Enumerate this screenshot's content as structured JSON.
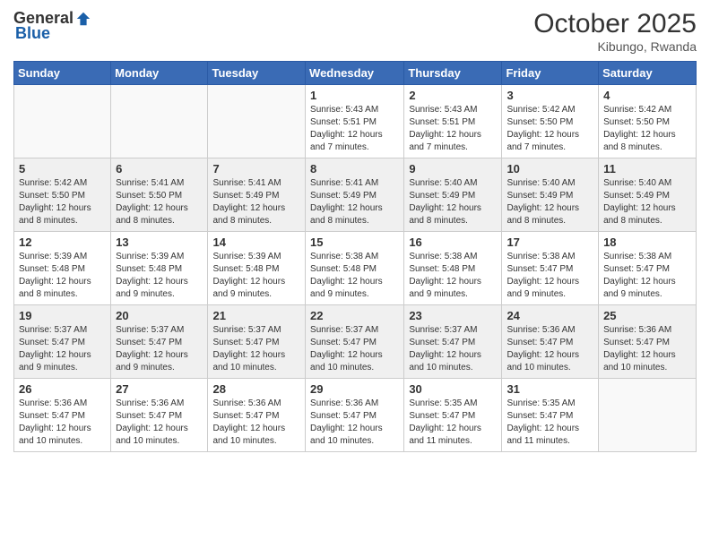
{
  "header": {
    "logo_general": "General",
    "logo_blue": "Blue",
    "month_year": "October 2025",
    "location": "Kibungo, Rwanda"
  },
  "days_of_week": [
    "Sunday",
    "Monday",
    "Tuesday",
    "Wednesday",
    "Thursday",
    "Friday",
    "Saturday"
  ],
  "weeks": [
    [
      {
        "day": "",
        "info": ""
      },
      {
        "day": "",
        "info": ""
      },
      {
        "day": "",
        "info": ""
      },
      {
        "day": "1",
        "info": "Sunrise: 5:43 AM\nSunset: 5:51 PM\nDaylight: 12 hours\nand 7 minutes."
      },
      {
        "day": "2",
        "info": "Sunrise: 5:43 AM\nSunset: 5:51 PM\nDaylight: 12 hours\nand 7 minutes."
      },
      {
        "day": "3",
        "info": "Sunrise: 5:42 AM\nSunset: 5:50 PM\nDaylight: 12 hours\nand 7 minutes."
      },
      {
        "day": "4",
        "info": "Sunrise: 5:42 AM\nSunset: 5:50 PM\nDaylight: 12 hours\nand 8 minutes."
      }
    ],
    [
      {
        "day": "5",
        "info": "Sunrise: 5:42 AM\nSunset: 5:50 PM\nDaylight: 12 hours\nand 8 minutes."
      },
      {
        "day": "6",
        "info": "Sunrise: 5:41 AM\nSunset: 5:50 PM\nDaylight: 12 hours\nand 8 minutes."
      },
      {
        "day": "7",
        "info": "Sunrise: 5:41 AM\nSunset: 5:49 PM\nDaylight: 12 hours\nand 8 minutes."
      },
      {
        "day": "8",
        "info": "Sunrise: 5:41 AM\nSunset: 5:49 PM\nDaylight: 12 hours\nand 8 minutes."
      },
      {
        "day": "9",
        "info": "Sunrise: 5:40 AM\nSunset: 5:49 PM\nDaylight: 12 hours\nand 8 minutes."
      },
      {
        "day": "10",
        "info": "Sunrise: 5:40 AM\nSunset: 5:49 PM\nDaylight: 12 hours\nand 8 minutes."
      },
      {
        "day": "11",
        "info": "Sunrise: 5:40 AM\nSunset: 5:49 PM\nDaylight: 12 hours\nand 8 minutes."
      }
    ],
    [
      {
        "day": "12",
        "info": "Sunrise: 5:39 AM\nSunset: 5:48 PM\nDaylight: 12 hours\nand 8 minutes."
      },
      {
        "day": "13",
        "info": "Sunrise: 5:39 AM\nSunset: 5:48 PM\nDaylight: 12 hours\nand 9 minutes."
      },
      {
        "day": "14",
        "info": "Sunrise: 5:39 AM\nSunset: 5:48 PM\nDaylight: 12 hours\nand 9 minutes."
      },
      {
        "day": "15",
        "info": "Sunrise: 5:38 AM\nSunset: 5:48 PM\nDaylight: 12 hours\nand 9 minutes."
      },
      {
        "day": "16",
        "info": "Sunrise: 5:38 AM\nSunset: 5:48 PM\nDaylight: 12 hours\nand 9 minutes."
      },
      {
        "day": "17",
        "info": "Sunrise: 5:38 AM\nSunset: 5:47 PM\nDaylight: 12 hours\nand 9 minutes."
      },
      {
        "day": "18",
        "info": "Sunrise: 5:38 AM\nSunset: 5:47 PM\nDaylight: 12 hours\nand 9 minutes."
      }
    ],
    [
      {
        "day": "19",
        "info": "Sunrise: 5:37 AM\nSunset: 5:47 PM\nDaylight: 12 hours\nand 9 minutes."
      },
      {
        "day": "20",
        "info": "Sunrise: 5:37 AM\nSunset: 5:47 PM\nDaylight: 12 hours\nand 9 minutes."
      },
      {
        "day": "21",
        "info": "Sunrise: 5:37 AM\nSunset: 5:47 PM\nDaylight: 12 hours\nand 10 minutes."
      },
      {
        "day": "22",
        "info": "Sunrise: 5:37 AM\nSunset: 5:47 PM\nDaylight: 12 hours\nand 10 minutes."
      },
      {
        "day": "23",
        "info": "Sunrise: 5:37 AM\nSunset: 5:47 PM\nDaylight: 12 hours\nand 10 minutes."
      },
      {
        "day": "24",
        "info": "Sunrise: 5:36 AM\nSunset: 5:47 PM\nDaylight: 12 hours\nand 10 minutes."
      },
      {
        "day": "25",
        "info": "Sunrise: 5:36 AM\nSunset: 5:47 PM\nDaylight: 12 hours\nand 10 minutes."
      }
    ],
    [
      {
        "day": "26",
        "info": "Sunrise: 5:36 AM\nSunset: 5:47 PM\nDaylight: 12 hours\nand 10 minutes."
      },
      {
        "day": "27",
        "info": "Sunrise: 5:36 AM\nSunset: 5:47 PM\nDaylight: 12 hours\nand 10 minutes."
      },
      {
        "day": "28",
        "info": "Sunrise: 5:36 AM\nSunset: 5:47 PM\nDaylight: 12 hours\nand 10 minutes."
      },
      {
        "day": "29",
        "info": "Sunrise: 5:36 AM\nSunset: 5:47 PM\nDaylight: 12 hours\nand 10 minutes."
      },
      {
        "day": "30",
        "info": "Sunrise: 5:35 AM\nSunset: 5:47 PM\nDaylight: 12 hours\nand 11 minutes."
      },
      {
        "day": "31",
        "info": "Sunrise: 5:35 AM\nSunset: 5:47 PM\nDaylight: 12 hours\nand 11 minutes."
      },
      {
        "day": "",
        "info": ""
      }
    ]
  ]
}
